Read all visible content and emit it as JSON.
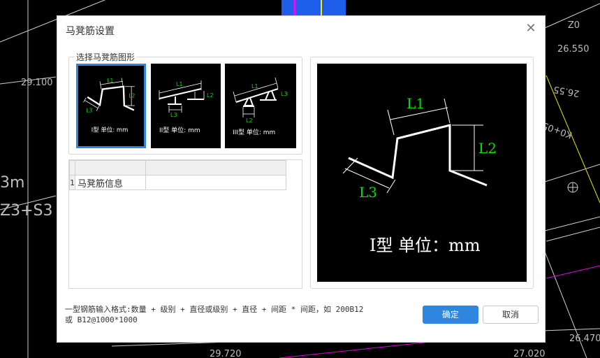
{
  "background": {
    "labels": [
      "29.100",
      "26.550",
      "3m",
      "Z3+S3",
      "29.720",
      "27.020",
      "26.470",
      "K0+050",
      "26.55",
      "0Z"
    ]
  },
  "dialog": {
    "title": "马凳筋设置",
    "close_icon": "close-icon",
    "group_label": "选择马凳筋图形",
    "shapes": [
      {
        "caption": "I型 单位: mm",
        "l1": "L1",
        "l2": "L2",
        "l3": "L3",
        "selected": true
      },
      {
        "caption": "II型 单位: mm",
        "l1": "L1",
        "l2": "L2",
        "l3": "L3",
        "selected": false
      },
      {
        "caption": "III型 单位: mm",
        "l1": "L1",
        "l2": "L2",
        "l3": "L3",
        "selected": false
      }
    ],
    "table": {
      "rows": [
        {
          "index": "1",
          "name": "马凳筋信息",
          "value": ""
        }
      ]
    },
    "preview": {
      "caption": "I型 单位：mm",
      "l1": "L1",
      "l2": "L2",
      "l3": "L3"
    },
    "hint_line1": "一型钢筋输入格式:数量 + 级别 + 直径或级别 + 直径 + 间距 * 间距，如 200B12",
    "hint_line2": "或 B12@1000*1000",
    "ok_label": "确定",
    "cancel_label": "取消"
  },
  "colors": {
    "accent": "#2e86de",
    "dim_green": "#00e000"
  }
}
